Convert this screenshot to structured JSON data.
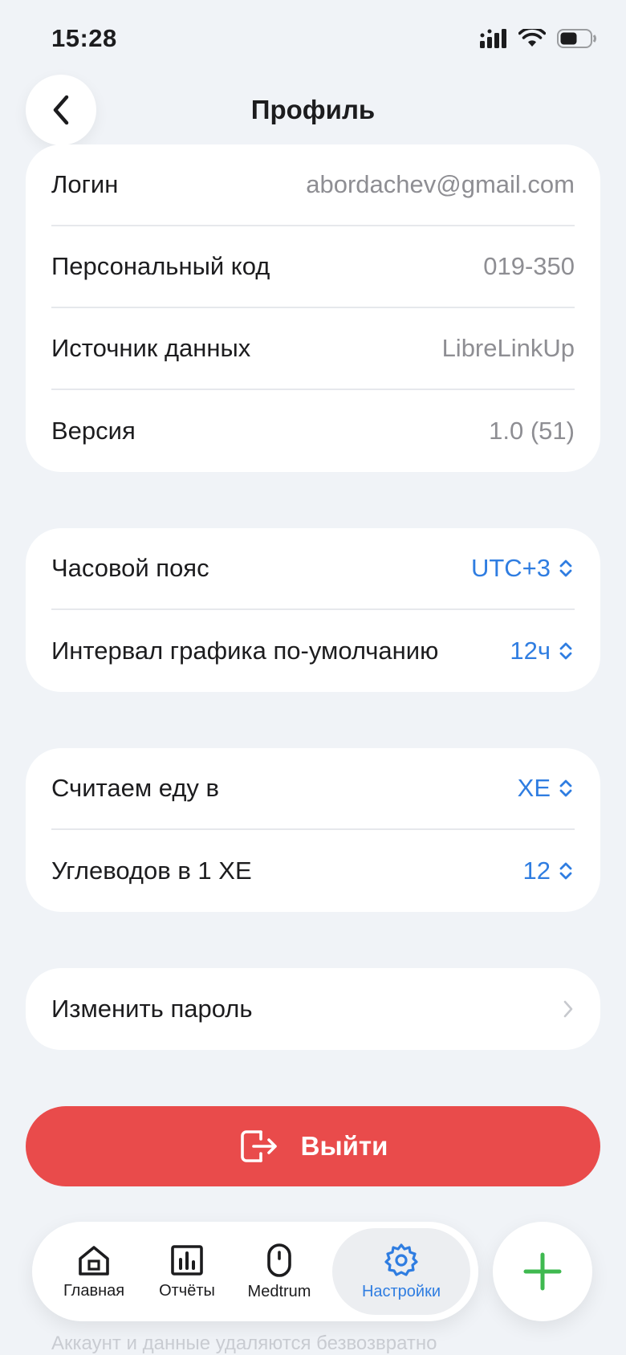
{
  "status_bar": {
    "time": "15:28"
  },
  "header": {
    "title": "Профиль"
  },
  "account_card": {
    "rows": [
      {
        "label": "Логин",
        "value": "abordachev@gmail.com"
      },
      {
        "label": "Персональный код",
        "value": "019-350"
      },
      {
        "label": "Источник данных",
        "value": "LibreLinkUp"
      },
      {
        "label": "Версия",
        "value": "1.0 (51)"
      }
    ]
  },
  "time_card": {
    "rows": [
      {
        "label": "Часовой пояс",
        "value": "UTC+3"
      },
      {
        "label": "Интервал графика по-умолчанию",
        "value": "12ч"
      }
    ]
  },
  "food_card": {
    "rows": [
      {
        "label": "Считаем еду в",
        "value": "ХЕ"
      },
      {
        "label": "Углеводов в 1 ХЕ",
        "value": "12"
      }
    ]
  },
  "password_card": {
    "label": "Изменить пароль"
  },
  "logout": {
    "label": "Выйти"
  },
  "hint": "Аккаунт и данные удаляются безвозвратно",
  "tab_bar": {
    "tabs": [
      {
        "label": "Главная",
        "icon": "home-icon"
      },
      {
        "label": "Отчёты",
        "icon": "chart-icon"
      },
      {
        "label": "Medtrum",
        "icon": "device-icon"
      },
      {
        "label": "Настройки",
        "icon": "gear-icon",
        "active": true
      }
    ]
  },
  "colors": {
    "accent": "#2f7de1",
    "danger": "#e94b4b",
    "fab_plus": "#3fb950",
    "background": "#f0f3f7"
  }
}
